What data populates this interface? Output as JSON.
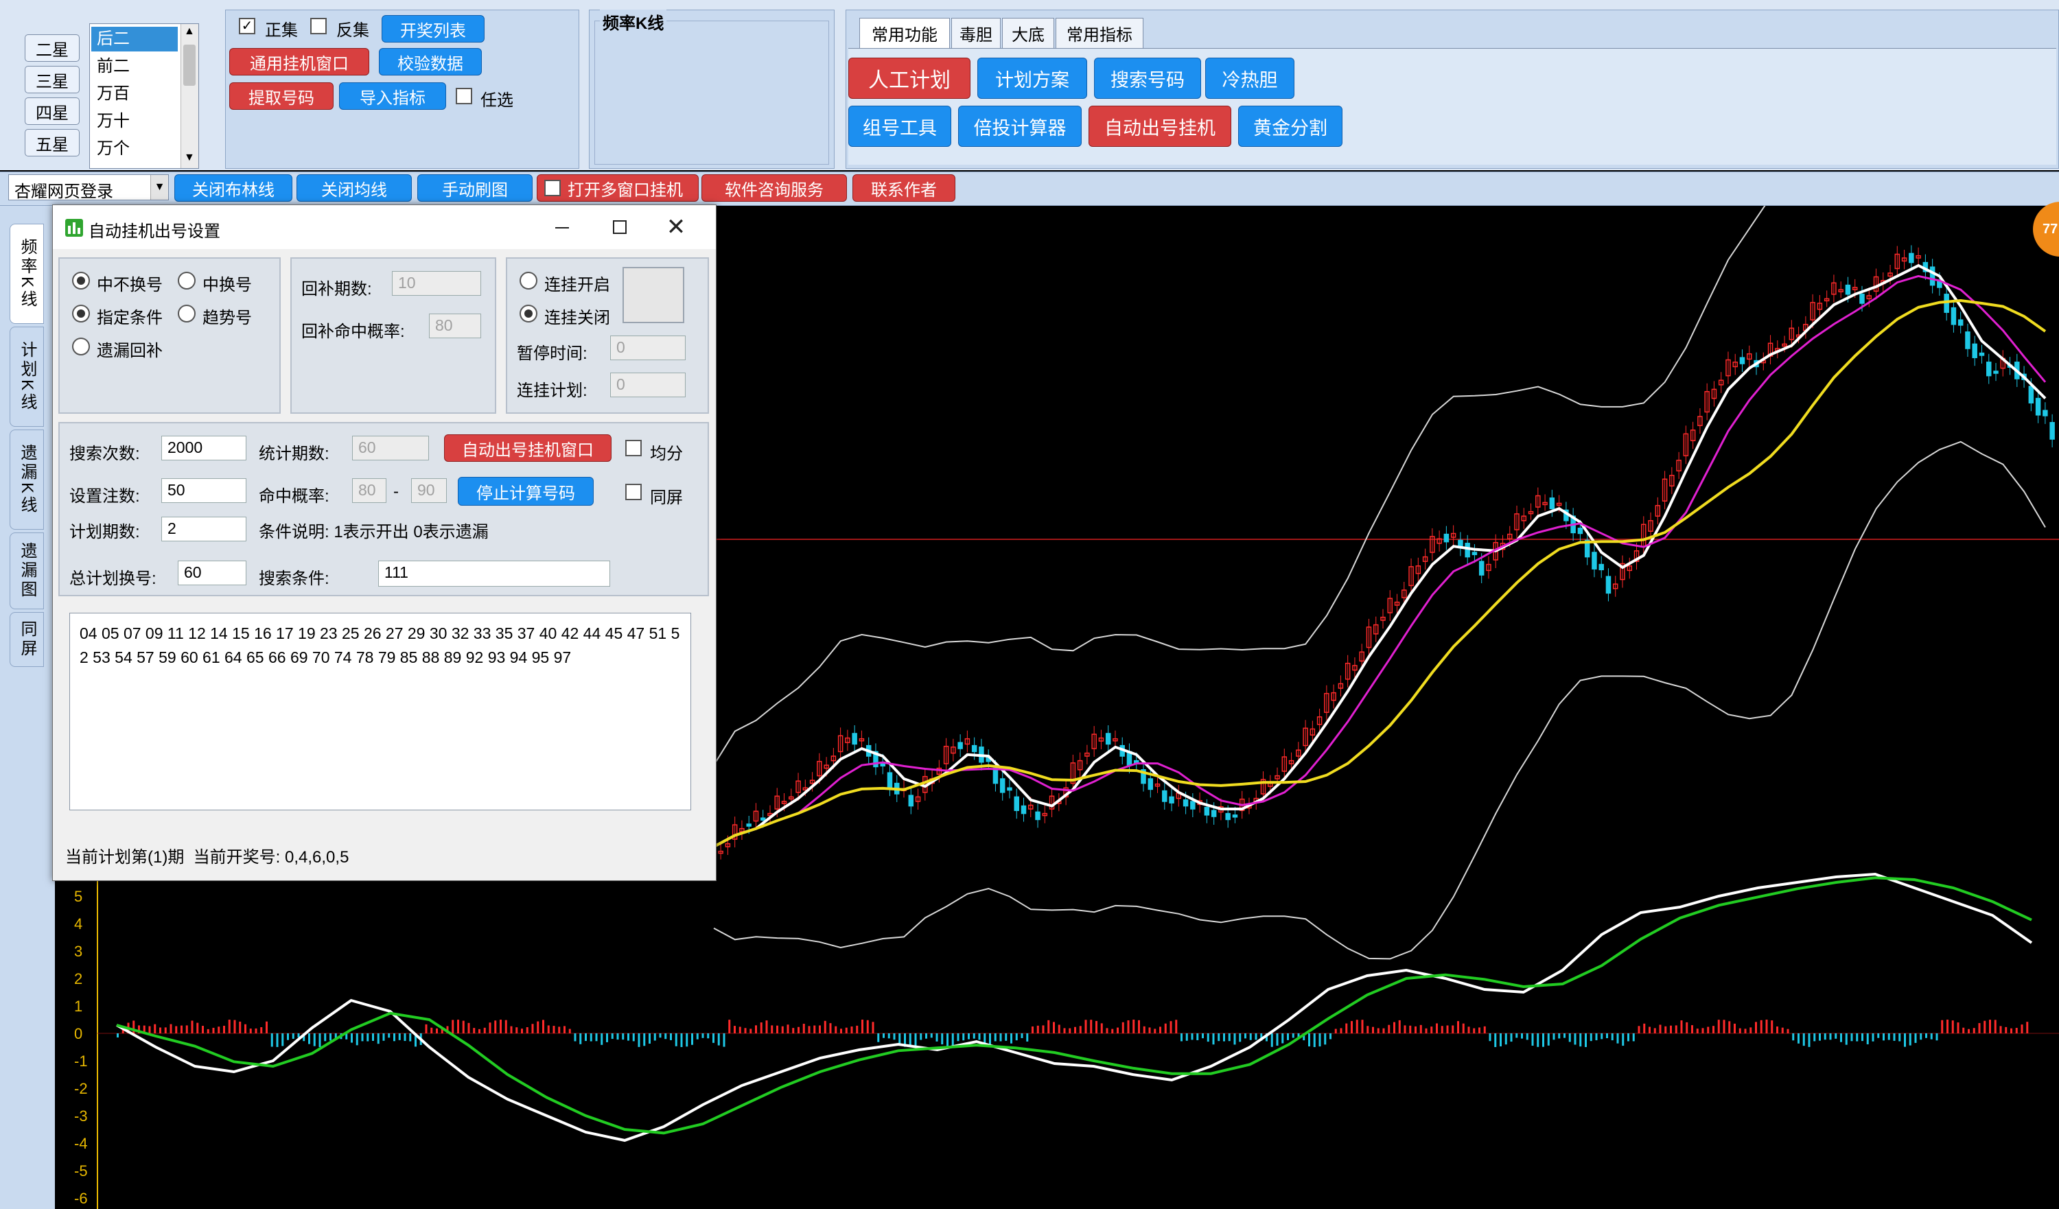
{
  "star_buttons": [
    "二星",
    "三星",
    "四星",
    "五星"
  ],
  "position_list": [
    "后二",
    "前二",
    "万百",
    "万十",
    "万个"
  ],
  "chk_zheng": "正集",
  "chk_fan": "反集",
  "btn_kaijiang": "开奖列表",
  "btn_tongyong": "通用挂机窗口",
  "btn_jiaoyan": "校验数据",
  "btn_tiqu": "提取号码",
  "btn_daoru": "导入指标",
  "chk_renxuan": "任选",
  "kline_group_title": "频率K线",
  "top_tabs": [
    "常用功能",
    "毒胆",
    "大底",
    "常用指标"
  ],
  "func_row1": [
    "人工计划",
    "计划方案",
    "搜索号码",
    "冷热胆"
  ],
  "func_row2": [
    "组号工具",
    "倍投计算器",
    "自动出号挂机",
    "黄金分割"
  ],
  "login_select": "杏耀网页登录",
  "toolbar2": [
    "关闭布林线",
    "关闭均线",
    "手动刷图",
    "打开多窗口挂机",
    "软件咨询服务",
    "联系作者"
  ],
  "side_tabs": [
    "频率K线",
    "计划K线",
    "遗漏K线",
    "遗漏图",
    "同屏"
  ],
  "float_badge": "77",
  "dialog": {
    "title": "自动挂机出号设置",
    "radio_bu_huan": "中不换号",
    "radio_huan": "中换号",
    "radio_zhiding": "指定条件",
    "radio_qushi": "趋势号",
    "radio_yilou": "遗漏回补",
    "lbl_huibu_qishu": "回补期数:",
    "val_huibu_qishu": "10",
    "lbl_huibu_gailv": "回补命中概率:",
    "val_huibu_gailv": "80",
    "radio_lian_on": "连挂开启",
    "radio_lian_off": "连挂关闭",
    "lbl_zanting": "暂停时间:",
    "val_zanting": "0",
    "lbl_lianjihua": "连挂计划:",
    "val_lianjihua": "0",
    "lbl_sousuo": "搜索次数:",
    "val_sousuo": "2000",
    "lbl_tongji": "统计期数:",
    "val_tongji": "60",
    "btn_auto": "自动出号挂机窗口",
    "chk_junfen": "均分",
    "lbl_zhushu": "设置注数:",
    "val_zhushu": "50",
    "lbl_mingzhong": "命中概率:",
    "val_mz_lo": "80",
    "mz_dash": "-",
    "val_mz_hi": "90",
    "btn_stop": "停止计算号码",
    "chk_tongping": "同屏",
    "lbl_jihua": "计划期数:",
    "val_jihua": "2",
    "lbl_tiaojian_sm": "条件说明: 1表示开出 0表示遗漏",
    "lbl_zong": "总计划换号:",
    "val_zong": "60",
    "lbl_tiaojian": "搜索条件:",
    "val_tiaojian": "111",
    "result_text": "04 05 07 09 11 12 14 15 16 17 19 23 25 26 27 29 30 32 33 35 37 40 42 44 45 47 51 52 53 54 57 59 60 61 64 65 66 69 70 74 78 79 85 88 89 92 93 94 95 97",
    "status": "当前计划第(1)期  当前开奖号: 0,4,6,0,5"
  },
  "lower_axis": [
    "5",
    "4",
    "3",
    "2",
    "1",
    "0",
    "-1",
    "-2",
    "-3",
    "-4",
    "-5",
    "-6"
  ],
  "colors": {
    "bull": "#ff2a2a",
    "bear": "#1ec8e6",
    "ma_yellow": "#f0dc20",
    "ma_magenta": "#e020d0",
    "boll": "#d8d8d8",
    "white": "#ffffff",
    "green": "#22cc22"
  },
  "chart_data": {
    "type": "candlestick",
    "note": "",
    "close": [
      -0.5,
      0,
      0.2,
      0.6,
      0.9,
      1.4,
      2.0,
      1.6,
      0.9,
      0.5,
      1.1,
      1.8,
      1.7,
      1.0,
      0.4,
      0.2,
      0.6,
      1.5,
      2.0,
      1.6,
      1.0,
      0.6,
      0.5,
      0.3,
      0.2,
      0.5,
      1.0,
      1.5,
      2.2,
      3.0,
      3.6,
      4.5,
      5.0,
      5.8,
      6.4,
      6.2,
      5.6,
      6.3,
      6.9,
      7.2,
      6.8,
      6.0,
      5.2,
      5.8,
      6.8,
      7.8,
      8.8,
      9.7,
      10.3,
      10.2,
      10.6,
      10.9,
      11.6,
      11.9,
      11.6,
      12.1,
      12.6,
      12.3,
      11.4,
      10.6,
      10.0,
      10.2,
      9.4,
      8.6
    ],
    "lower_indicator": [
      0.3,
      -0.5,
      -1.2,
      -1.4,
      -1.0,
      0.2,
      1.2,
      0.8,
      -0.5,
      -1.6,
      -2.4,
      -3.0,
      -3.6,
      -3.9,
      -3.4,
      -2.6,
      -1.9,
      -1.4,
      -0.9,
      -0.6,
      -0.4,
      -0.6,
      -0.3,
      -0.7,
      -1.1,
      -1.2,
      -1.5,
      -1.7,
      -1.2,
      -0.5,
      0.5,
      1.6,
      2.1,
      2.3,
      2.0,
      1.6,
      1.5,
      2.3,
      3.6,
      4.4,
      4.6,
      5.0,
      5.3,
      5.5,
      5.7,
      5.8,
      5.3,
      4.8,
      4.3,
      3.3
    ]
  }
}
